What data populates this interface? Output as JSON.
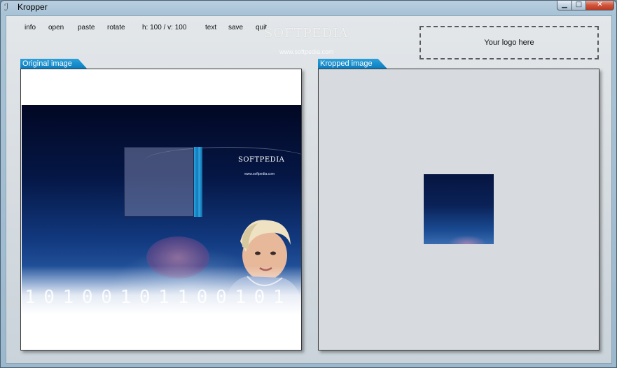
{
  "window": {
    "title": "Kropper",
    "controls": {
      "minimize": "▁",
      "maximize": "□",
      "close": "✕"
    }
  },
  "menu": {
    "items": [
      {
        "id": "info",
        "label": "info"
      },
      {
        "id": "open",
        "label": "open"
      },
      {
        "id": "paste",
        "label": "paste"
      },
      {
        "id": "rotate",
        "label": "rotate"
      },
      {
        "id": "text",
        "label": "text"
      },
      {
        "id": "save",
        "label": "save"
      },
      {
        "id": "quit",
        "label": "quit"
      }
    ],
    "size_readout": "h: 100 / v: 100"
  },
  "logo_placeholder": "Your logo here",
  "watermark": {
    "name": "SOFTPEDIA",
    "url": "www.softpedia.com"
  },
  "panels": {
    "original": {
      "label": "Original image"
    },
    "kropped": {
      "label": "Kropped image"
    }
  },
  "image": {
    "brand": "SOFTPEDIA",
    "brand_url": "www.softpedia.com",
    "digits": "1 0 1 0 0 1 0 1 1 0 0 1 0 1"
  },
  "colors": {
    "tab_accent": "#0b7cc0",
    "crop_handle": "#27a4df"
  }
}
